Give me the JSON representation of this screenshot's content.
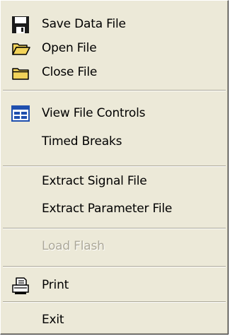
{
  "menu": {
    "items": [
      {
        "label": "Save Data File",
        "icon": "floppy-disk-icon",
        "enabled": true
      },
      {
        "label": "Open File",
        "icon": "open-folder-icon",
        "enabled": true
      },
      {
        "label": "Close File",
        "icon": "closed-folder-icon",
        "enabled": true
      },
      {
        "label": "View File Controls",
        "icon": "file-controls-icon",
        "enabled": true
      },
      {
        "label": "Timed Breaks",
        "icon": "",
        "enabled": true
      },
      {
        "label": "Extract Signal File",
        "icon": "",
        "enabled": true
      },
      {
        "label": "Extract Parameter File",
        "icon": "",
        "enabled": true
      },
      {
        "label": "Load Flash",
        "icon": "",
        "enabled": false
      },
      {
        "label": "Print",
        "icon": "printer-icon",
        "enabled": true
      },
      {
        "label": "Exit",
        "icon": "",
        "enabled": true
      }
    ]
  },
  "colors": {
    "menu_background": "#ece9d8",
    "separator_dark": "#aca899",
    "disabled_text": "#aca899",
    "folder_yellow": "#f2d35a",
    "icon_blue": "#1f4fae"
  }
}
